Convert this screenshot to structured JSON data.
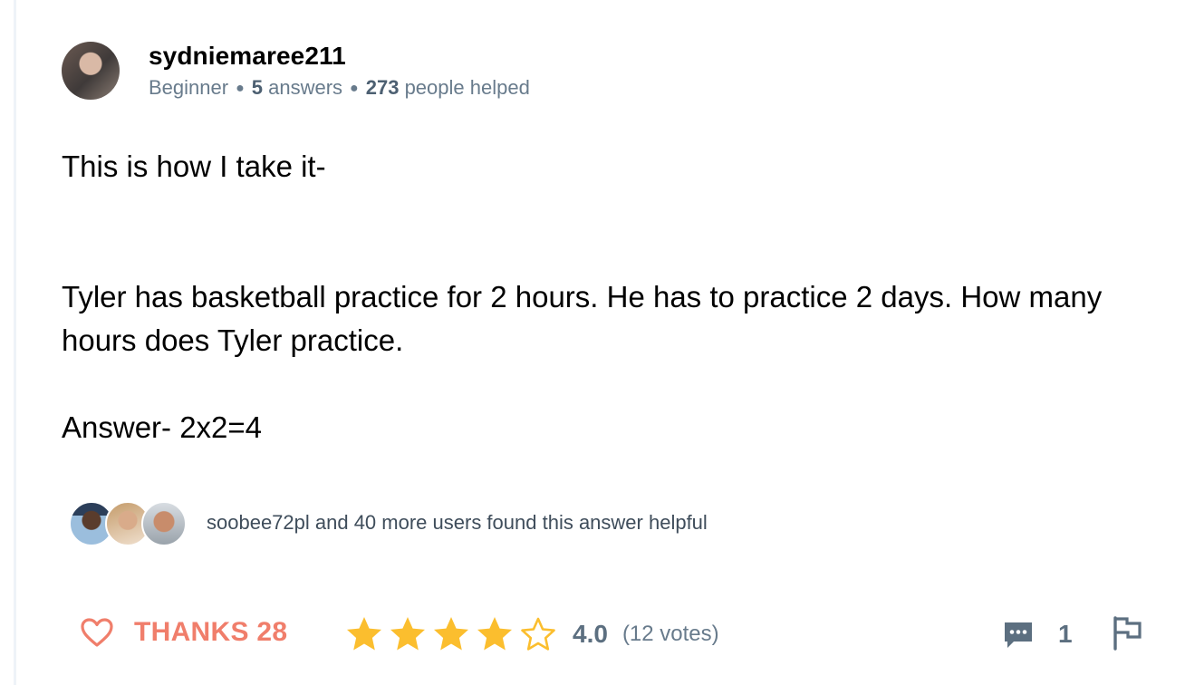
{
  "author": {
    "name": "sydniemaree211",
    "rank": "Beginner",
    "answers_count": "5",
    "answers_label": "answers",
    "helped_count": "273",
    "helped_label": "people helped"
  },
  "answer": {
    "paragraphs": [
      "This is how I take it-",
      "Tyler has basketball practice for 2 hours. He has to practice 2 days. How many hours does Tyler practice.",
      "Answer- 2x2=4"
    ]
  },
  "helpful": {
    "text": "soobee72pl and 40 more users found this answer helpful"
  },
  "actions": {
    "thanks_label": "THANKS 28",
    "rating_value": "4.0",
    "rating_votes": "(12 votes)",
    "rating_stars_filled": 4,
    "rating_stars_total": 5,
    "comment_count": "1"
  },
  "icons": {
    "thanks": "heart-outline-icon",
    "star_filled": "star-filled-icon",
    "star_empty": "star-outline-icon",
    "comments": "comment-bubble-icon",
    "report": "flag-icon"
  },
  "colors": {
    "accent_thanks": "#f07e6b",
    "star": "#fbbe2e",
    "meta_text": "#687b8c",
    "icon_gray": "#5c6f80"
  }
}
